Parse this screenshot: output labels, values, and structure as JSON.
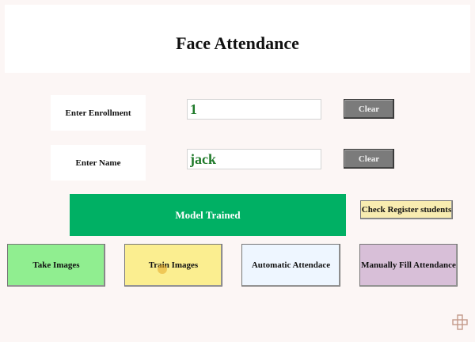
{
  "app": {
    "title": "Face Attendance"
  },
  "form": {
    "enrollment_label": "Enter Enrollment",
    "enrollment_value": "1",
    "name_label": "Enter Name",
    "name_value": "jack",
    "clear_label": "Clear"
  },
  "status": {
    "message": "Model Trained"
  },
  "buttons": {
    "check_register": "Check Register students",
    "take_images": "Take Images",
    "train_images": "Train Images",
    "automatic_attendance": "Automatic Attendace",
    "manual_attendance": "Manually Fill Attendance"
  },
  "icons": {
    "corner": "move-cursor-icon"
  },
  "colors": {
    "status_bg": "#00b064",
    "take_images_bg": "#90ee90",
    "train_images_bg": "#fbee90",
    "automatic_bg": "#eef6ff",
    "manual_bg": "#d8bfd8",
    "check_register_bg": "#f8ecb0",
    "clear_bg": "#7b7b7b"
  }
}
